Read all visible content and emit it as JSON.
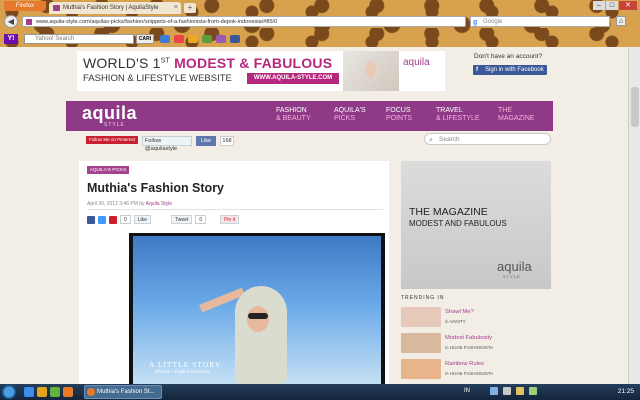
{
  "browser": {
    "app_button": "Firefox",
    "tab_title": "Muthia's Fashion Story | AquilaStyle",
    "new_tab": "+",
    "url": "www.aquila-style.com/aquilas-picks/fashion/snippets-of-a-fashionista-from-depok-indonesia/#85/0",
    "search_engine": "Google",
    "nav_back": "◀",
    "home": "⌂",
    "window_buttons": [
      "–",
      "□",
      "✕"
    ]
  },
  "yahoo_toolbar": {
    "logo": "Y!",
    "search_placeholder": "Yahoo! Search",
    "search_button": "CARI"
  },
  "banner": {
    "line1_prefix": "WORLD'S 1",
    "line1_super": "ST",
    "line1_highlight": "MODEST & FABULOUS",
    "line2": "FASHION & LIFESTYLE WEBSITE",
    "url_badge": "WWW.AQUILA-STYLE.COM",
    "brand": "aquila"
  },
  "account": {
    "prompt": "Don't have an account?",
    "facebook_button": "Sign in with Facebook",
    "facebook_icon": "f"
  },
  "nav": {
    "logo": "aquila",
    "logo_sub": "STYLE",
    "items": [
      {
        "line1": "FASHION",
        "line2": "& BEAUTY"
      },
      {
        "line1": "AQUILA'S",
        "line2": "PICKS"
      },
      {
        "line1": "FOCUS",
        "line2": "POINTS"
      },
      {
        "line1": "TRAVEL",
        "line2": "& LIFESTYLE"
      },
      {
        "line1": "THE",
        "line2": "MAGAZINE"
      }
    ]
  },
  "social": {
    "pinterest": "Follow Me on Pinterest",
    "twitter": "Follow @aquilastyle",
    "like": "Like",
    "like_count": "168"
  },
  "search": {
    "placeholder": "Search",
    "icon": "⌕"
  },
  "article": {
    "tag": "AQUILA'S PICKS",
    "title": "Muthia's Fashion Story",
    "date": "April 20, 2012 3:46 PM by",
    "author": "Aquila Style",
    "share": {
      "fb_count": "0",
      "like": "Like",
      "tweet": "Tweet",
      "tweet_count": "0",
      "pin": "Pin it"
    },
    "photo_caption": "A LITTLE STORY",
    "photo_caption_sub": "Muthia – Hijab Fashionista"
  },
  "sidebar": {
    "ad_line1": "THE MAGAZINE",
    "ad_line2": "MODEST AND FABULOUS",
    "ad_logo": "aquila",
    "ad_logo_sub": "STYLE",
    "trending_header": "TRENDING IN",
    "trending": [
      {
        "title": "Shawl Me?",
        "category": "in VANITY",
        "color": "#e7c9b9"
      },
      {
        "title": "Modest Fabulosity",
        "category": "in HIJAB FASHIONISTA",
        "color": "#d9b99e"
      },
      {
        "title": "Rainbow Rules",
        "category": "in HIJAB FASHIONISTA",
        "color": "#e8b48c"
      }
    ]
  },
  "taskbar": {
    "app": "Muthia's Fashion St...",
    "lang": "IN",
    "clock": "21:25"
  },
  "colors": {
    "brand_purple": "#8e3a86",
    "accent_pink": "#b5287d",
    "facebook_blue": "#3b5998"
  }
}
